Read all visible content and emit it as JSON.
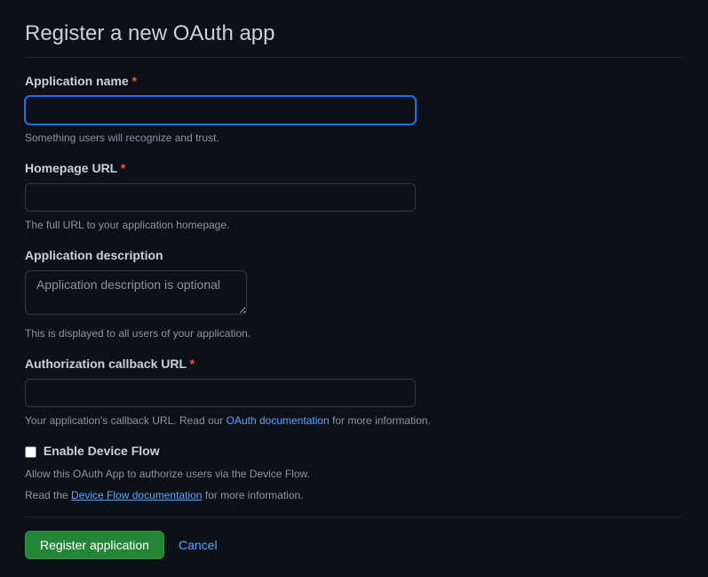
{
  "page_title": "Register a new OAuth app",
  "fields": {
    "app_name": {
      "label": "Application name",
      "required_mark": "*",
      "help": "Something users will recognize and trust.",
      "value": ""
    },
    "homepage_url": {
      "label": "Homepage URL",
      "required_mark": "*",
      "help": "The full URL to your application homepage.",
      "value": ""
    },
    "description": {
      "label": "Application description",
      "placeholder": "Application description is optional",
      "help": "This is displayed to all users of your application.",
      "value": ""
    },
    "callback_url": {
      "label": "Authorization callback URL",
      "required_mark": "*",
      "help_prefix": "Your application's callback URL. Read our ",
      "help_link": "OAuth documentation",
      "help_suffix": " for more information.",
      "value": ""
    },
    "device_flow": {
      "label": "Enable Device Flow",
      "help_line1": "Allow this OAuth App to authorize users via the Device Flow.",
      "help_line2_prefix": "Read the ",
      "help_line2_link": "Device Flow documentation",
      "help_line2_suffix": " for more information."
    }
  },
  "actions": {
    "submit": "Register application",
    "cancel": "Cancel"
  }
}
